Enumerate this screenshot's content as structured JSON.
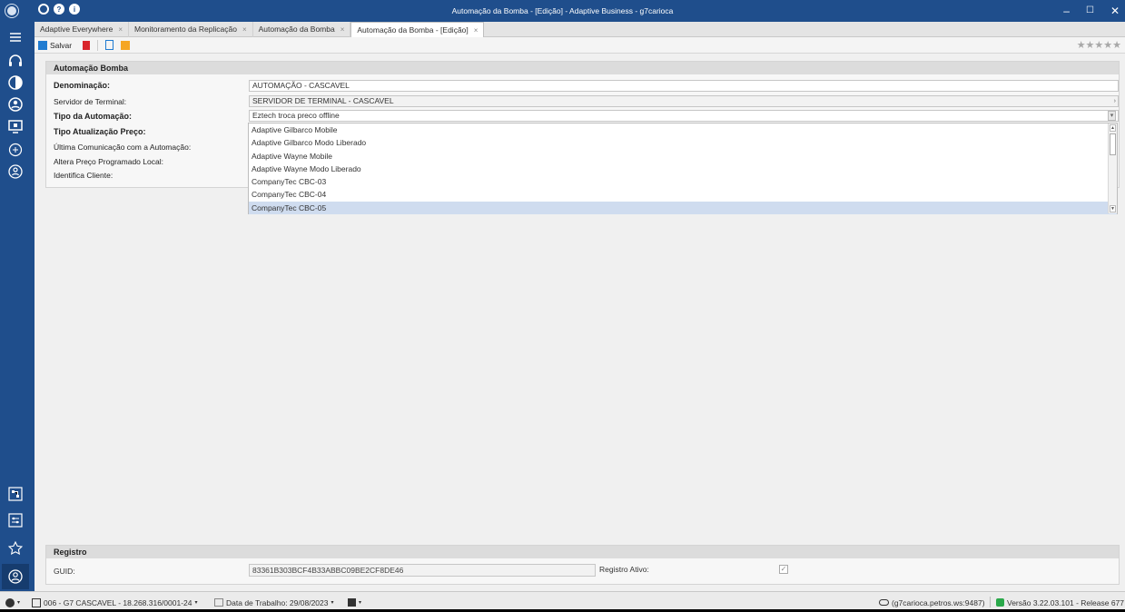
{
  "window": {
    "title": "Automação da Bomba - [Edição] - Adaptive Business - g7carioca",
    "controls": [
      "–",
      "☐",
      "✕"
    ]
  },
  "tabs": [
    {
      "label": "Adaptive Everywhere"
    },
    {
      "label": "Monitoramento da Replicação"
    },
    {
      "label": "Automação da Bomba"
    },
    {
      "label": "Automação da Bomba - [Edição]"
    }
  ],
  "toolbar": {
    "save_label": "Salvar",
    "rating": "★★★★★"
  },
  "form": {
    "section_title": "Automação Bomba",
    "fields": {
      "denominacao": {
        "label": "Denominação:",
        "value": "AUTOMAÇÃO - CASCAVEL"
      },
      "servidor": {
        "label": "Servidor de Terminal:",
        "value": "SERVIDOR DE TERMINAL - CASCAVEL"
      },
      "tipo_automacao": {
        "label": "Tipo da Automação:",
        "value": "Eztech troca preco offline"
      },
      "tipo_atualizacao": {
        "label": "Tipo Atualização Preço:"
      },
      "ultima_comunicacao": {
        "label": "Última Comunicação com a Automação:"
      },
      "altera_preco": {
        "label": "Altera Preço Programado Local:"
      },
      "identifica_cliente": {
        "label": "Identifica Cliente:"
      }
    },
    "dropdown_options": [
      "Adaptive Gilbarco Mobile",
      "Adaptive Gilbarco Modo Liberado",
      "Adaptive Wayne Mobile",
      "Adaptive Wayne Modo Liberado",
      "CompanyTec CBC-03",
      "CompanyTec CBC-04",
      "CompanyTec CBC-05"
    ],
    "dropdown_selected": "CompanyTec CBC-05"
  },
  "registro": {
    "section_title": "Registro",
    "guid_label": "GUID:",
    "guid_value": "83361B303BCF4B33ABBC09BE2CF8DE46",
    "ativo_label": "Registro Ativo:",
    "ativo_checked": true
  },
  "statusbar": {
    "company": "006 - G7 CASCAVEL - 18.268.316/0001-24",
    "work_date": "Data de Trabalho: 29/08/2023",
    "server": "(g7carioca.petros.ws:9487)",
    "version": "Versão 3.22.03.101 - Release 677"
  },
  "colors": {
    "brand": "#1f4e8c",
    "selection": "#cfdcef",
    "delete_red": "#d9252b",
    "note_orange": "#f5a623"
  }
}
